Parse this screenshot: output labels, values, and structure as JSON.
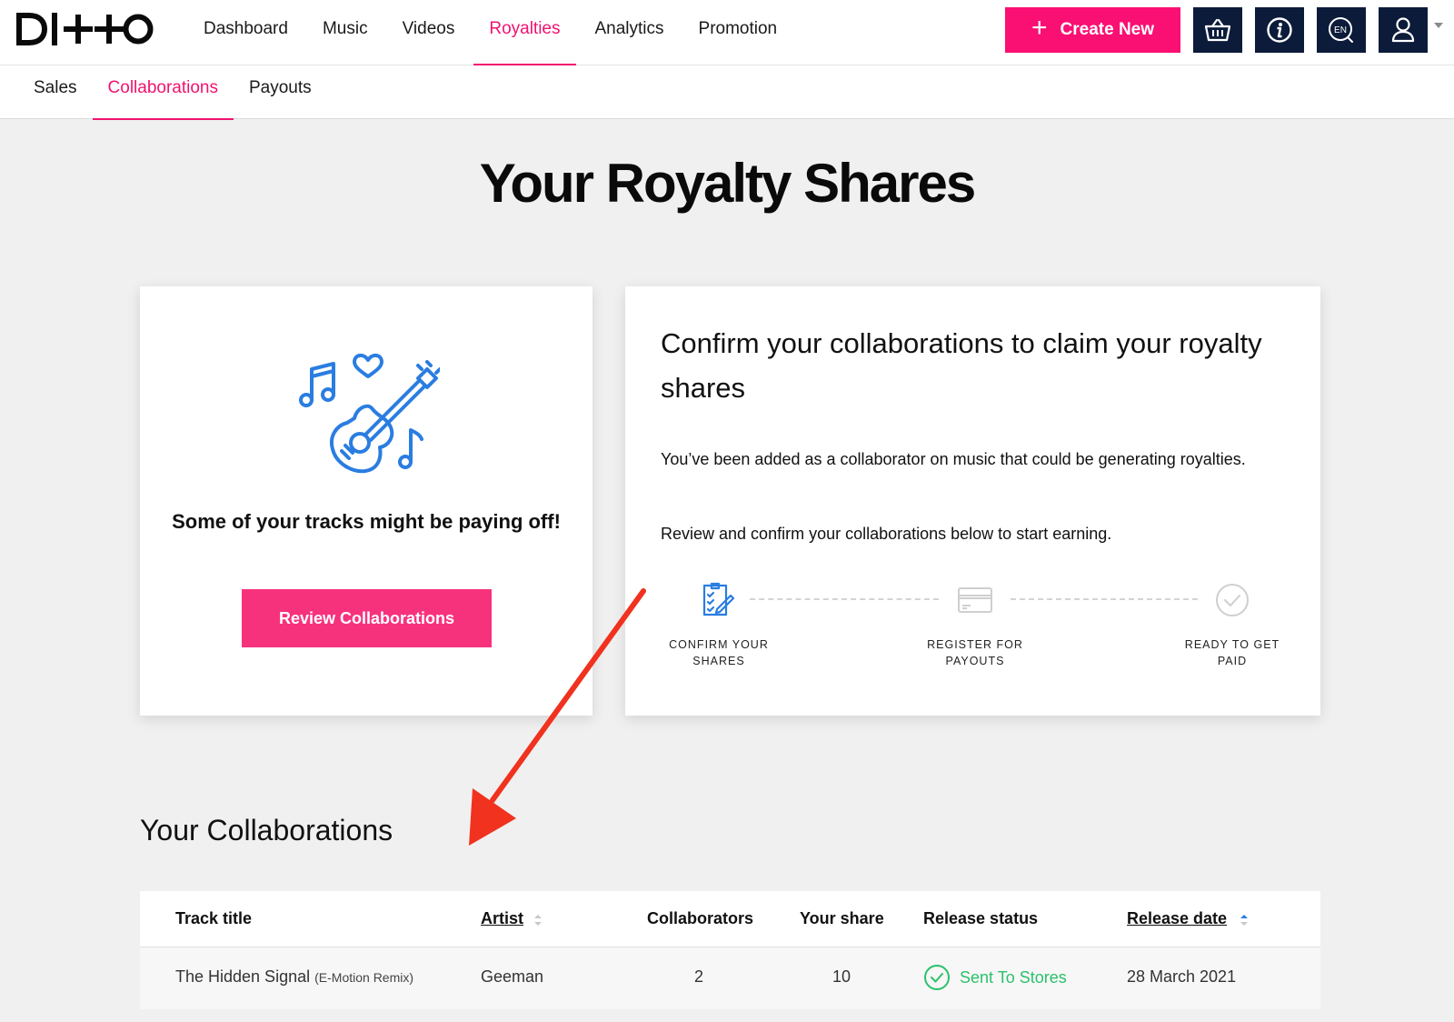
{
  "logo": {
    "text": "DITTO"
  },
  "nav": {
    "items": [
      "Dashboard",
      "Music",
      "Videos",
      "Royalties",
      "Analytics",
      "Promotion"
    ],
    "active": "Royalties"
  },
  "header": {
    "create_label": "Create New",
    "language": "EN"
  },
  "subnav": {
    "items": [
      "Sales",
      "Collaborations",
      "Payouts"
    ],
    "active": "Collaborations"
  },
  "page": {
    "title": "Your Royalty Shares"
  },
  "promo_card": {
    "tagline": "Some of your tracks might be paying off!",
    "button_label": "Review Collaborations"
  },
  "info_card": {
    "title": "Confirm your collaborations to claim your royalty shares",
    "paragraph1": "You’ve been added as a collaborator on music that could be generating royalties.",
    "paragraph2": "Review and confirm your collaborations below to start earning.",
    "steps": [
      {
        "line1": "CONFIRM YOUR",
        "line2": "SHARES",
        "icon": "checklist-icon"
      },
      {
        "line1": "REGISTER FOR",
        "line2": "PAYOUTS",
        "icon": "credit-card-icon"
      },
      {
        "line1": "READY TO GET",
        "line2": "PAID",
        "icon": "check-circle-icon"
      }
    ]
  },
  "collaborations": {
    "title": "Your Collaborations",
    "columns": {
      "track": "Track title",
      "artist": "Artist",
      "collaborators": "Collaborators",
      "share": "Your share",
      "status": "Release status",
      "date": "Release date"
    },
    "rows": [
      {
        "track": "The Hidden Signal",
        "track_sub": "(E-Motion Remix)",
        "artist": "Geeman",
        "collaborators": "2",
        "share": "10",
        "status": "Sent To Stores",
        "date": "28 March 2021"
      }
    ]
  },
  "colors": {
    "accent": "#f0136f",
    "navy": "#0c1b3a",
    "illustration": "#2a7de1",
    "status_green": "#2bc16b",
    "annotation_arrow": "#f0321e"
  }
}
